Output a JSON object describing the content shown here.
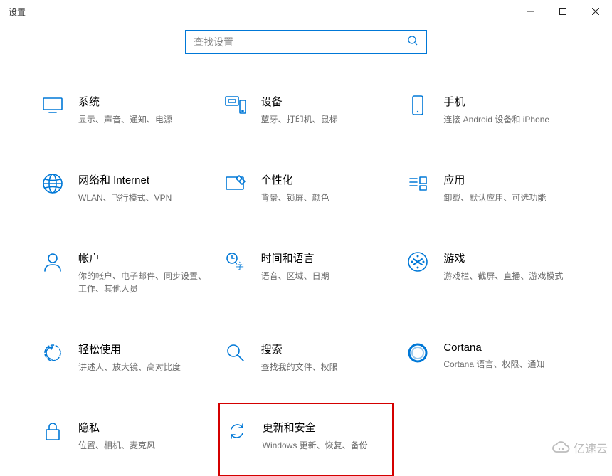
{
  "window": {
    "title": "设置"
  },
  "search": {
    "placeholder": "查找设置"
  },
  "tiles": [
    {
      "id": "system",
      "title": "系统",
      "desc": "显示、声音、通知、电源"
    },
    {
      "id": "devices",
      "title": "设备",
      "desc": "蓝牙、打印机、鼠标"
    },
    {
      "id": "phone",
      "title": "手机",
      "desc": "连接 Android 设备和 iPhone"
    },
    {
      "id": "network",
      "title": "网络和 Internet",
      "desc": "WLAN、飞行模式、VPN"
    },
    {
      "id": "personalization",
      "title": "个性化",
      "desc": "背景、锁屏、颜色"
    },
    {
      "id": "apps",
      "title": "应用",
      "desc": "卸载、默认应用、可选功能"
    },
    {
      "id": "accounts",
      "title": "帐户",
      "desc": "你的帐户、电子邮件、同步设置、工作、其他人员"
    },
    {
      "id": "time",
      "title": "时间和语言",
      "desc": "语音、区域、日期"
    },
    {
      "id": "gaming",
      "title": "游戏",
      "desc": "游戏栏、截屏、直播、游戏模式"
    },
    {
      "id": "ease",
      "title": "轻松使用",
      "desc": "讲述人、放大镜、高对比度"
    },
    {
      "id": "search-cat",
      "title": "搜索",
      "desc": "查找我的文件、权限"
    },
    {
      "id": "cortana",
      "title": "Cortana",
      "desc": "Cortana 语言、权限、通知"
    },
    {
      "id": "privacy",
      "title": "隐私",
      "desc": "位置、相机、麦克风"
    },
    {
      "id": "update",
      "title": "更新和安全",
      "desc": "Windows 更新、恢复、备份",
      "highlighted": true
    }
  ],
  "watermark": {
    "text": "亿速云"
  }
}
